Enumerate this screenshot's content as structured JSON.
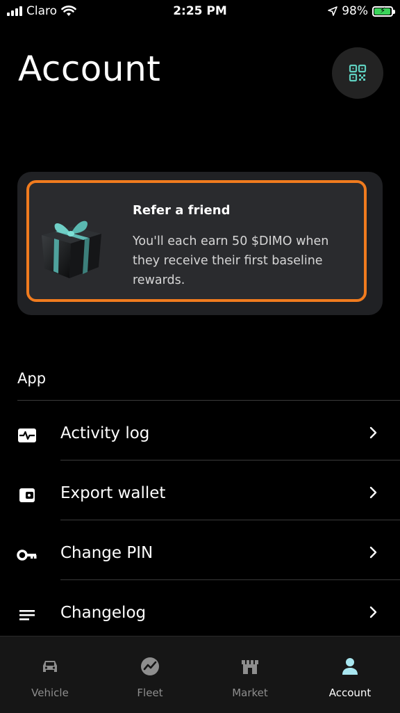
{
  "status_bar": {
    "carrier": "Claro",
    "time": "2:25 PM",
    "battery_percent": "98%",
    "battery_level": 0.98,
    "battery_color": "#3ad45a"
  },
  "header": {
    "title": "Account",
    "qr_icon": "qr-code-icon",
    "qr_icon_color": "#5fd0c0"
  },
  "refer_card": {
    "title": "Refer a friend",
    "body": "You'll each earn 50 $DIMO when they receive their first baseline rewards.",
    "highlight_color": "#f07b1e",
    "icon": "gift-icon"
  },
  "app_section": {
    "title": "App",
    "items": [
      {
        "label": "Activity log",
        "icon": "activity-icon"
      },
      {
        "label": "Export wallet",
        "icon": "wallet-icon"
      },
      {
        "label": "Change PIN",
        "icon": "key-icon"
      },
      {
        "label": "Changelog",
        "icon": "list-icon"
      }
    ]
  },
  "tab_bar": {
    "tabs": [
      {
        "label": "Vehicle",
        "icon": "car-icon",
        "active": false
      },
      {
        "label": "Fleet",
        "icon": "chart-icon",
        "active": false
      },
      {
        "label": "Market",
        "icon": "store-icon",
        "active": false
      },
      {
        "label": "Account",
        "icon": "person-icon",
        "active": true
      }
    ],
    "active_color": "#a8e6ef"
  }
}
